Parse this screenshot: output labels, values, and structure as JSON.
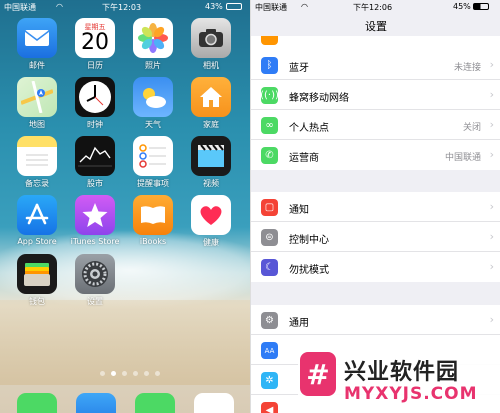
{
  "home": {
    "status": {
      "carrier": "中国联通",
      "time": "下午12:03",
      "battery": "43%"
    },
    "date_weekday": "星期五",
    "date_day": "20",
    "apps": [
      {
        "label": "邮件",
        "icon": "mail-icon"
      },
      {
        "label": "日历",
        "icon": "calendar-icon"
      },
      {
        "label": "照片",
        "icon": "photos-icon"
      },
      {
        "label": "相机",
        "icon": "camera-icon"
      },
      {
        "label": "地图",
        "icon": "maps-icon"
      },
      {
        "label": "时钟",
        "icon": "clock-icon"
      },
      {
        "label": "天气",
        "icon": "weather-icon"
      },
      {
        "label": "家庭",
        "icon": "home-icon"
      },
      {
        "label": "备忘录",
        "icon": "notes-icon"
      },
      {
        "label": "股市",
        "icon": "stocks-icon"
      },
      {
        "label": "提醒事项",
        "icon": "reminders-icon"
      },
      {
        "label": "视频",
        "icon": "videos-icon"
      },
      {
        "label": "App Store",
        "icon": "app-store-icon"
      },
      {
        "label": "iTunes Store",
        "icon": "itunes-store-icon"
      },
      {
        "label": "iBooks",
        "icon": "ibooks-icon"
      },
      {
        "label": "健康",
        "icon": "health-icon"
      },
      {
        "label": "钱包",
        "icon": "wallet-icon"
      },
      {
        "label": "设置",
        "icon": "settings-icon"
      }
    ],
    "page_dots": 6,
    "active_dot": 1
  },
  "settings": {
    "status": {
      "carrier": "中国联通",
      "time": "下午12:06",
      "battery": "45%"
    },
    "title": "设置",
    "group1": [
      {
        "label": "蓝牙",
        "value": "未连接",
        "icon": "bluetooth-icon",
        "color": "#2f7cf6"
      },
      {
        "label": "蜂窝移动网络",
        "value": "",
        "icon": "cellular-icon",
        "color": "#4cd964"
      },
      {
        "label": "个人热点",
        "value": "关闭",
        "icon": "hotspot-icon",
        "color": "#4cd964"
      },
      {
        "label": "运营商",
        "value": "中国联通",
        "icon": "carrier-icon",
        "color": "#4cd964"
      }
    ],
    "group2": [
      {
        "label": "通知",
        "value": "",
        "icon": "notifications-icon",
        "color": "#f44336"
      },
      {
        "label": "控制中心",
        "value": "",
        "icon": "control-center-icon",
        "color": "#8e8e93"
      },
      {
        "label": "勿扰模式",
        "value": "",
        "icon": "do-not-disturb-icon",
        "color": "#5856d6"
      }
    ],
    "group3": [
      {
        "label": "通用",
        "value": "",
        "icon": "gear-icon",
        "color": "#8e8e93"
      },
      {
        "label": "",
        "value": "",
        "icon": "display-icon",
        "color": "#2f7cf6"
      },
      {
        "label": "",
        "value": "",
        "icon": "wallpaper-icon",
        "color": "#2fb5f6"
      },
      {
        "label": "",
        "value": "",
        "icon": "sounds-icon",
        "color": "#f44336"
      }
    ]
  },
  "watermark": {
    "title": "兴业软件园",
    "url": "MYXYJS.COM",
    "logo": "#"
  }
}
